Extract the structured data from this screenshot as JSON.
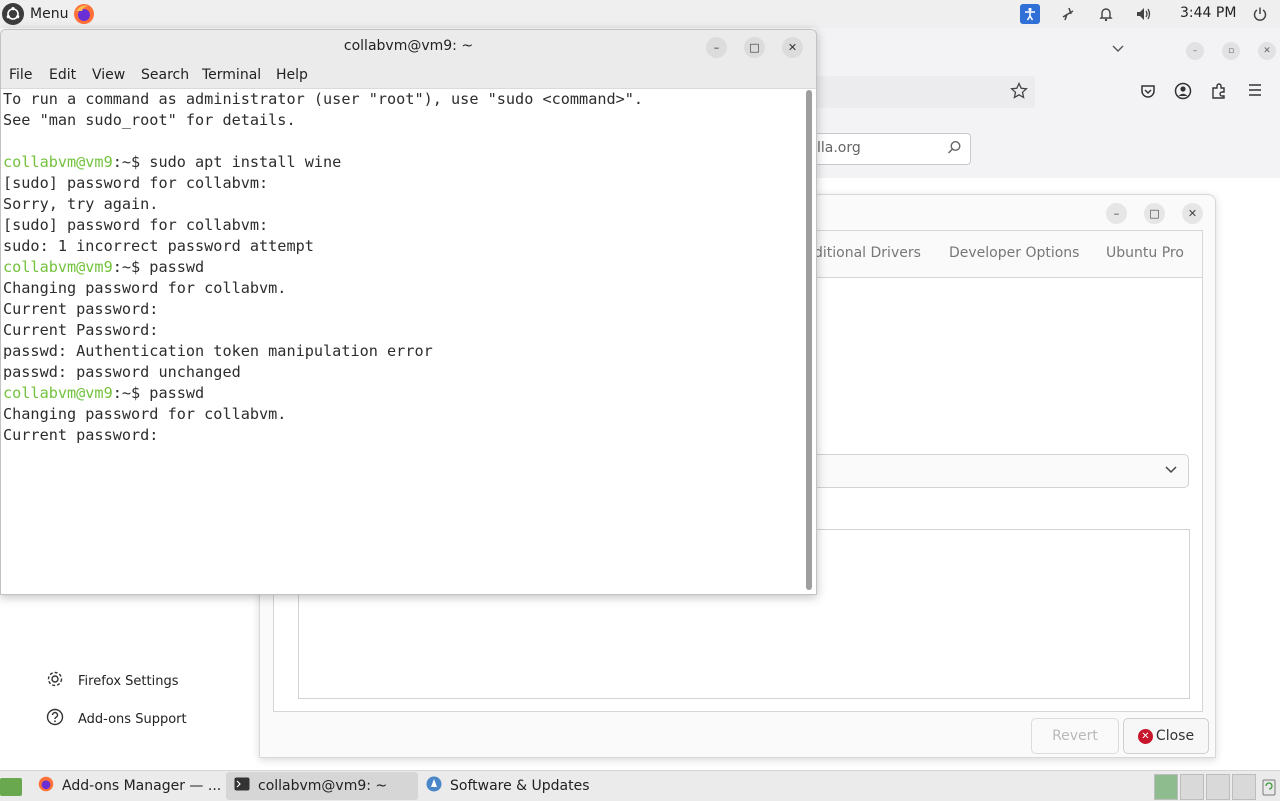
{
  "top_panel": {
    "menu_label": "Menu",
    "clock": "3:44 PM",
    "icons": [
      "ubuntu-logo-icon",
      "firefox-icon",
      "accessibility-icon",
      "network-icon",
      "notification-bell-icon",
      "volume-icon",
      "power-icon"
    ]
  },
  "terminal": {
    "title": "collabvm@vm9: ~",
    "menu": [
      "File",
      "Edit",
      "View",
      "Search",
      "Terminal",
      "Help"
    ],
    "lines": [
      {
        "prompt": "",
        "text": "To run a command as administrator (user \"root\"), use \"sudo <command>\"."
      },
      {
        "prompt": "",
        "text": "See \"man sudo_root\" for details."
      },
      {
        "prompt": "",
        "text": ""
      },
      {
        "prompt": "collabvm@vm9",
        "text": ":~$ sudo apt install wine"
      },
      {
        "prompt": "",
        "text": "[sudo] password for collabvm:"
      },
      {
        "prompt": "",
        "text": "Sorry, try again."
      },
      {
        "prompt": "",
        "text": "[sudo] password for collabvm:"
      },
      {
        "prompt": "",
        "text": "sudo: 1 incorrect password attempt"
      },
      {
        "prompt": "collabvm@vm9",
        "text": ":~$ passwd"
      },
      {
        "prompt": "",
        "text": "Changing password for collabvm."
      },
      {
        "prompt": "",
        "text": "Current password:"
      },
      {
        "prompt": "",
        "text": "Current Password:"
      },
      {
        "prompt": "",
        "text": "passwd: Authentication token manipulation error"
      },
      {
        "prompt": "",
        "text": "passwd: password unchanged"
      },
      {
        "prompt": "collabvm@vm9",
        "text": ":~$ passwd"
      },
      {
        "prompt": "",
        "text": "Changing password for collabvm."
      },
      {
        "prompt": "",
        "text": "Current password:"
      }
    ]
  },
  "firefox": {
    "search_text": "lla.org",
    "sidebar_links": [
      "Firefox Settings",
      "Add-ons Support"
    ]
  },
  "software_updates": {
    "tabs": [
      "ditional Drivers",
      "Developer Options",
      "Ubuntu Pro"
    ],
    "revert_label": "Revert",
    "close_label": "Close"
  },
  "taskbar": {
    "tasks": [
      "Add-ons Manager — ...",
      "collabvm@vm9: ~",
      "Software & Updates"
    ]
  },
  "colors": {
    "prompt_green": "#73c23d",
    "accent_blue": "#2f6fd6",
    "close_red": "#c7162b"
  }
}
